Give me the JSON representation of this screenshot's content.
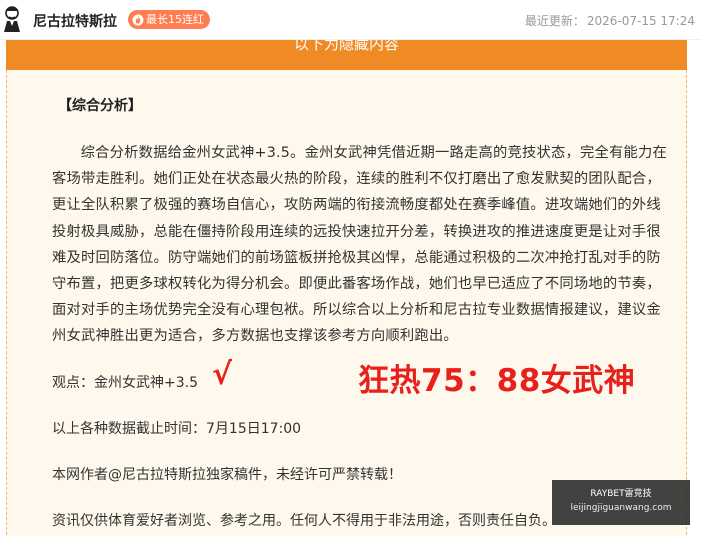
{
  "header": {
    "author": "尼古拉特斯拉",
    "streak_badge": "最长15连红",
    "updated_label": "最近更新：",
    "updated_time": "2026-07-15 17:24"
  },
  "article": {
    "hidden_banner": "以下为隐藏内容",
    "section_title": "【综合分析】",
    "analysis": "综合分析数据给金州女武神+3.5。金州女武神凭借近期一路走高的竞技状态，完全有能力在客场带走胜利。她们正处在状态最火热的阶段，连续的胜利不仅打磨出了愈发默契的团队配合，更让全队积累了极强的赛场自信心，攻防两端的衔接流畅度都处在赛季峰值。进攻端她们的外线投射极具威胁，总能在僵持阶段用连续的远投快速拉开分差，转换进攻的推进速度更是让对手很难及时回防落位。防守端她们的前场篮板拼抢极其凶悍，总能通过积极的二次冲抢打乱对手的防守布置，把更多球权转化为得分机会。即便此番客场作战，她们也早已适应了不同场地的节奏，面对对手的主场优势完全没有心理包袱。所以综合以上分析和尼古拉专业数据情报建议，建议金州女武神胜出更为适合，多方数据也支撑该参考方向顺利跑出。",
    "viewpoint": "观点：金州女武神+3.5",
    "check_mark": "√",
    "result_stamp": "狂热75：88女武神",
    "cutoff": "以上各种数据截止时间：7月15日17:00",
    "copyright": "本网作者@尼古拉特斯拉独家稿件，未经许可严禁转载！",
    "disclaimer": "资讯仅供体育爱好者浏览、参考之用。任何人不得用于非法用途，否则责任自负。"
  },
  "watermark": {
    "title": "RAYBET雷竞技",
    "url": "leijingjiguanwang.com"
  },
  "colors": {
    "accent_orange": "#f08a24",
    "badge_orange": "#ff7d50",
    "result_red": "#e8201b",
    "panel_bg": "#fff8ec"
  }
}
